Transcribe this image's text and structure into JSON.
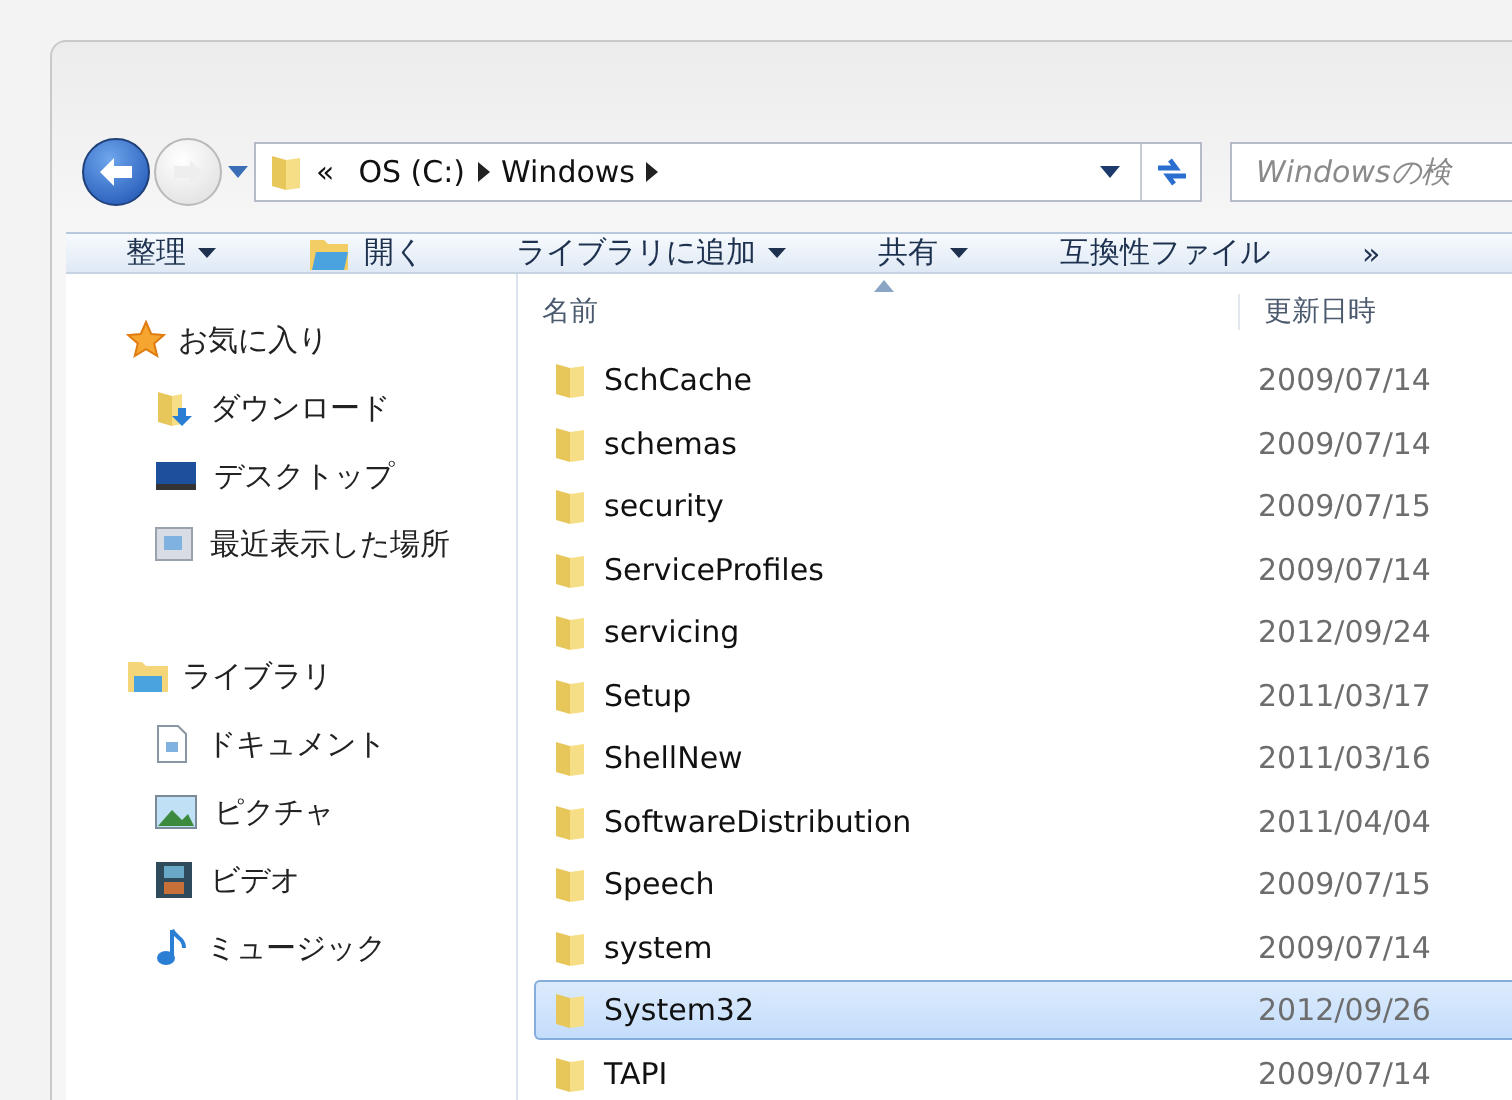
{
  "navigation": {
    "breadcrumb": [
      "«",
      "OS (C:)",
      "Windows"
    ],
    "search": {
      "placeholder": "Windowsの検"
    }
  },
  "toolbar": {
    "items": [
      {
        "label": "整理",
        "kind": "dropdown"
      },
      {
        "label": "開く",
        "kind": "icon"
      },
      {
        "label": "ライブラリに追加",
        "kind": "dropdown"
      },
      {
        "label": "共有",
        "kind": "dropdown"
      },
      {
        "label": "互換性ファイル",
        "kind": "plain"
      }
    ],
    "overflow": "»"
  },
  "sidebar": {
    "groups": [
      {
        "title": "お気に入り",
        "kind": "favorites",
        "items": [
          {
            "label": "ダウンロード",
            "kind": "downloads"
          },
          {
            "label": "デスクトップ",
            "kind": "desktop"
          },
          {
            "label": "最近表示した場所",
            "kind": "recent"
          }
        ]
      },
      {
        "title": "ライブラリ",
        "kind": "libraries",
        "items": [
          {
            "label": "ドキュメント",
            "kind": "documents"
          },
          {
            "label": "ピクチャ",
            "kind": "pictures"
          },
          {
            "label": "ビデオ",
            "kind": "videos"
          },
          {
            "label": "ミュージック",
            "kind": "music"
          }
        ]
      }
    ]
  },
  "files": {
    "columns": [
      "名前",
      "更新日時"
    ],
    "rows": [
      {
        "name": "SchCache",
        "date": "2009/07/14",
        "selected": false
      },
      {
        "name": "schemas",
        "date": "2009/07/14",
        "selected": false
      },
      {
        "name": "security",
        "date": "2009/07/15",
        "selected": false
      },
      {
        "name": "ServiceProfiles",
        "date": "2009/07/14",
        "selected": false
      },
      {
        "name": "servicing",
        "date": "2012/09/24",
        "selected": false
      },
      {
        "name": "Setup",
        "date": "2011/03/17",
        "selected": false
      },
      {
        "name": "ShellNew",
        "date": "2011/03/16",
        "selected": false
      },
      {
        "name": "SoftwareDistribution",
        "date": "2011/04/04",
        "selected": false
      },
      {
        "name": "Speech",
        "date": "2009/07/15",
        "selected": false
      },
      {
        "name": "system",
        "date": "2009/07/14",
        "selected": false
      },
      {
        "name": "System32",
        "date": "2012/09/26",
        "selected": true
      },
      {
        "name": "TAPI",
        "date": "2009/07/14",
        "selected": false
      }
    ]
  }
}
